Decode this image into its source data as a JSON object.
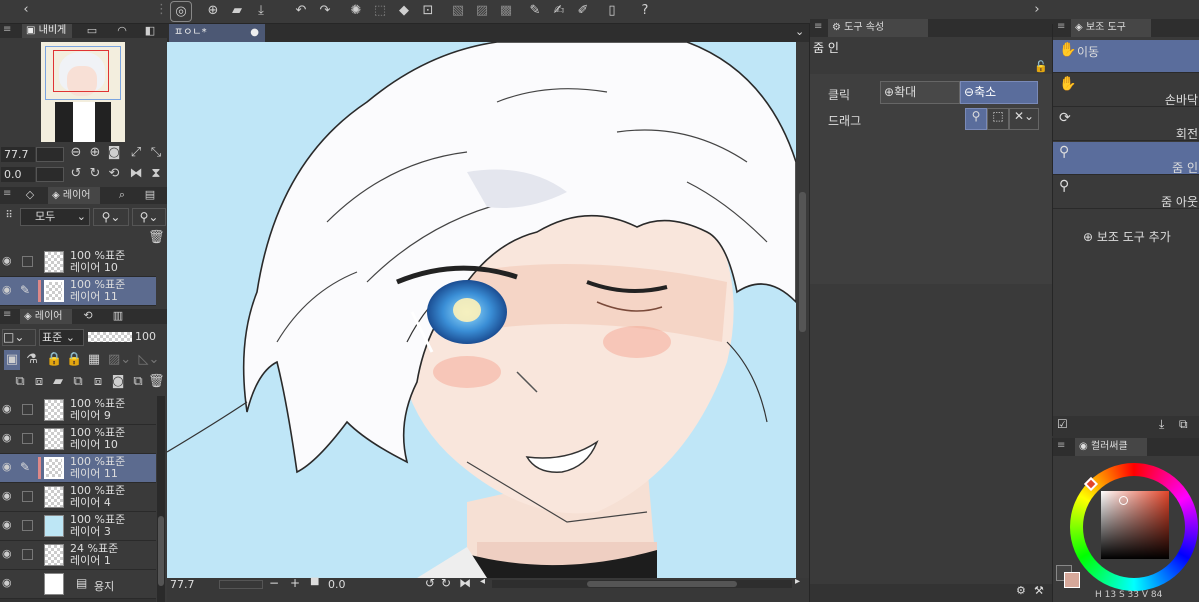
{
  "navigator": {
    "tab": "내비게",
    "zoom": "77.7",
    "angle": "0.0"
  },
  "layer_panel_top": {
    "tab": "레이어",
    "blend_mode": "모두",
    "layers": [
      {
        "opacity": "100 %",
        "mode": "표준",
        "name": "레이어 10",
        "selected": false,
        "thumb": "checker"
      },
      {
        "opacity": "100 %",
        "mode": "표준",
        "name": "레이어 11",
        "selected": true,
        "thumb": "checker"
      }
    ]
  },
  "layer_panel": {
    "tab": "레이어",
    "blend_mode": "표준",
    "opacity": "100",
    "layers": [
      {
        "opacity": "100 %",
        "mode": "표준",
        "name": "레이어 9",
        "selected": false,
        "thumb": "checker"
      },
      {
        "opacity": "100 %",
        "mode": "표준",
        "name": "레이어 10",
        "selected": false,
        "thumb": "checker"
      },
      {
        "opacity": "100 %",
        "mode": "표준",
        "name": "레이어 11",
        "selected": true,
        "thumb": "checker"
      },
      {
        "opacity": "100 %",
        "mode": "표준",
        "name": "레이어 4",
        "selected": false,
        "thumb": "checker"
      },
      {
        "opacity": "100 %",
        "mode": "표준",
        "name": "레이어 3",
        "selected": false,
        "thumb": "#bde6f5"
      },
      {
        "opacity": "24 %",
        "mode": "표준",
        "name": "레이어 1",
        "selected": false,
        "thumb": "checker"
      }
    ],
    "paper": {
      "name": "용지"
    }
  },
  "canvas": {
    "tab": "ㅍㅇㄴ*",
    "zoom": "77.7",
    "angle": "0.0",
    "bg": "#bfe6f7"
  },
  "tool_property": {
    "tab": "도구 속성",
    "title": "줌 인",
    "click_label": "클릭",
    "zoom_in": "확대",
    "zoom_out": "축소",
    "drag_label": "드래그"
  },
  "sub_tool": {
    "tab": "보조 도구",
    "items": [
      {
        "label": "이동",
        "icon": "hand-icon",
        "selected": true,
        "align": "left"
      },
      {
        "label": "손바닥",
        "icon": "hand-icon",
        "selected": false,
        "align": "right"
      },
      {
        "label": "회전",
        "icon": "rotate-icon",
        "selected": false,
        "align": "right"
      },
      {
        "label": "줌 인",
        "icon": "magnifier-icon",
        "selected": true,
        "align": "right"
      },
      {
        "label": "줌 아웃",
        "icon": "magnifier-icon",
        "selected": false,
        "align": "right"
      }
    ],
    "add_label": "보조 도구 추가"
  },
  "color": {
    "tab": "컬러써클",
    "h": "13",
    "s": "33",
    "v": "84",
    "hue_color": "#e2452a"
  }
}
